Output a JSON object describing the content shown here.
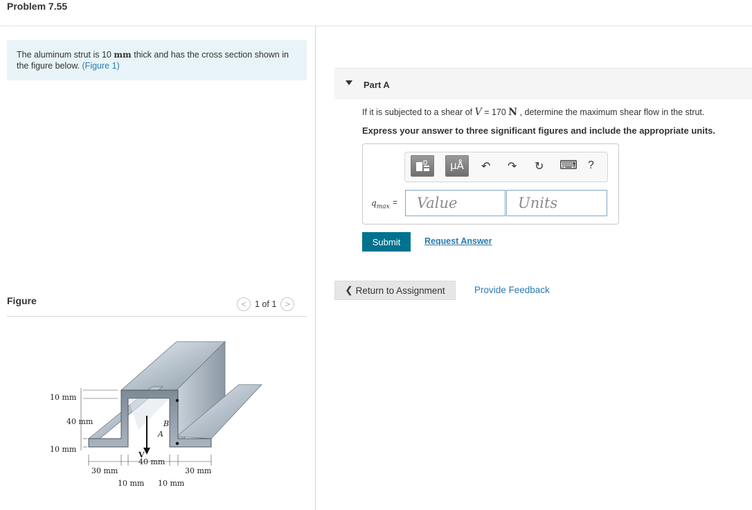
{
  "page": {
    "title": "Problem 7.55"
  },
  "intro": {
    "text_before": "The aluminum strut is 10 ",
    "unit": "mm",
    "text_after": " thick and has the cross section shown in the figure below. ",
    "figure_link": "(Figure 1)"
  },
  "figure": {
    "label": "Figure",
    "pager": {
      "prev": "<",
      "position": "1 of 1",
      "next": ">"
    },
    "annotations": {
      "dim_top": "10 mm",
      "dim_mid": "40 mm",
      "dim_bottom": "10 mm",
      "dim_base_center": "40 mm",
      "dim_base_left": "30 mm",
      "dim_base_right": "30 mm",
      "dim_lower_left": "10 mm",
      "dim_lower_right": "10 mm",
      "point_b": "B",
      "point_a": "A",
      "shear": "V"
    }
  },
  "part": {
    "title": "Part A",
    "question_prefix": "If it is subjected to a shear of ",
    "question_var": "V",
    "question_eq": " = 170 ",
    "question_unit": "N",
    "question_suffix": " , determine the maximum shear flow in the strut.",
    "instruction": "Express your answer to three significant figures and include the appropriate units.",
    "toolbar": {
      "template_symbol": "μÅ",
      "undo": "↶",
      "redo": "↷",
      "reset": "↻",
      "keyboard": "⌨",
      "help": "?"
    },
    "answer": {
      "var_main": "q",
      "var_sub": "max",
      "equals": "=",
      "value_placeholder": "Value",
      "units_placeholder": "Units"
    },
    "submit_label": "Submit",
    "request_label": "Request Answer"
  },
  "footer": {
    "return_arrow": "❮",
    "return_label": "Return to Assignment",
    "feedback_label": "Provide Feedback"
  }
}
